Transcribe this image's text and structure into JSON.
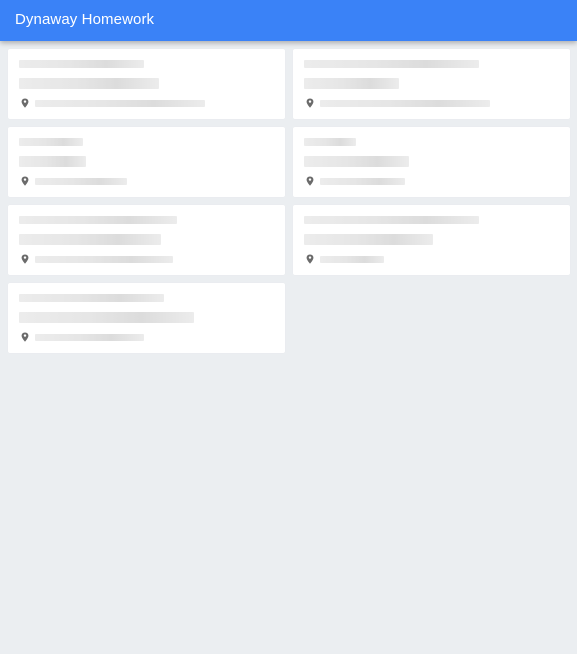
{
  "app": {
    "title": "Dynaway Homework"
  },
  "icons": {
    "location": "map-pin-icon"
  },
  "colors": {
    "app_bar": "#3a82f7",
    "background": "#ebeef1",
    "card": "#ffffff",
    "skeleton": "#e4e4e4",
    "pin": "#6b6b6b"
  },
  "cards": [
    {
      "name": "card-1",
      "state": "loading-placeholder"
    },
    {
      "name": "card-2",
      "state": "loading-placeholder"
    },
    {
      "name": "card-3",
      "state": "loading-placeholder"
    },
    {
      "name": "card-4",
      "state": "loading-placeholder"
    },
    {
      "name": "card-5",
      "state": "loading-placeholder"
    },
    {
      "name": "card-6",
      "state": "loading-placeholder"
    },
    {
      "name": "card-7",
      "state": "loading-placeholder"
    }
  ]
}
